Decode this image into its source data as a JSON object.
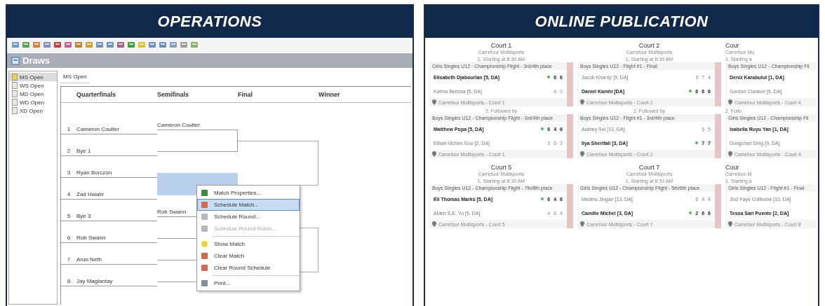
{
  "operations": {
    "heading": "OPERATIONS",
    "panel_title": "Draws",
    "draws": [
      {
        "label": "MS Open",
        "selected": true
      },
      {
        "label": "WS Open",
        "selected": false
      },
      {
        "label": "MD Open",
        "selected": false
      },
      {
        "label": "WD Open",
        "selected": false
      },
      {
        "label": "XD Open",
        "selected": false
      }
    ],
    "tab": "MS Open",
    "columns": [
      "Quarterfinals",
      "Semifinals",
      "Final",
      "Winner"
    ],
    "quarterfinals": [
      {
        "seed": "1",
        "name": "Cameron Coulter"
      },
      {
        "seed": "2",
        "name": "Bye 1"
      },
      {
        "seed": "3",
        "name": "Ryan Borczon"
      },
      {
        "seed": "4",
        "name": "Zad Halabi"
      },
      {
        "seed": "5",
        "name": "Bye 3"
      },
      {
        "seed": "6",
        "name": "Rob Swann"
      },
      {
        "seed": "7",
        "name": "Arun Neth"
      },
      {
        "seed": "8",
        "name": "Jay Maglantay"
      }
    ],
    "semifinals": [
      {
        "name": "Cameron Coulter",
        "selected": false
      },
      {
        "selected": true
      },
      {
        "name": "Rob Swann",
        "selected": false
      },
      {
        "selected": false
      }
    ],
    "context_menu": [
      [
        {
          "label": "Match Properties...",
          "selected": false,
          "disabled": false
        },
        {
          "label": "Schedule Match...",
          "selected": true,
          "disabled": false
        },
        {
          "label": "Schedule Round...",
          "selected": false,
          "disabled": false
        },
        {
          "label": "Schedule Round Robin...",
          "selected": false,
          "disabled": true
        }
      ],
      [
        {
          "label": "Show Match",
          "selected": false,
          "disabled": false
        },
        {
          "label": "Clear Match",
          "selected": false,
          "disabled": false
        },
        {
          "label": "Clear Round Schedule",
          "selected": false,
          "disabled": false
        }
      ],
      [
        {
          "label": "Print...",
          "selected": false,
          "disabled": false
        }
      ]
    ]
  },
  "online_publication": {
    "heading": "ONLINE PUBLICATION",
    "courts": [
      {
        "title": "Court 1",
        "venue": "Carrefour Multisports",
        "matches": [
          {
            "order": "1. Starting at 8:30 AM",
            "event": "Girls Singles U12 - Championship Flight - 3rd/4th place",
            "players": [
              {
                "name": "Elisabeth Djabourian [5, DA]",
                "winner": true,
                "scores": [
                  "6",
                  "6"
                ]
              },
              {
                "name": "Karina Bersixa [5, DA]",
                "winner": false,
                "scores": [
                  "4",
                  "0"
                ]
              }
            ],
            "location": "Carrefour Multisports - Court 1"
          },
          {
            "order": "2. Followed by",
            "event": "Boys Singles U12 - Championship Flight - 3rd/4th place",
            "players": [
              {
                "name": "Matthew Popa [5, DA]",
                "winner": true,
                "scores": [
                  "6",
                  "4",
                  "6"
                ]
              },
              {
                "name": "Ethan Vichen Guo [2, DA]",
                "winner": false,
                "scores": [
                  "3",
                  "6",
                  "3"
                ]
              }
            ],
            "location": "Carrefour Multisports - Court 1"
          }
        ]
      },
      {
        "title": "Court 2",
        "venue": "Carrefour Multisports",
        "matches": [
          {
            "order": "1. Starting at 8:30 AM",
            "event": "Boys Singles U12 - Flight #1 - Final",
            "players": [
              {
                "name": "Jacob Kharrip [9, DA]",
                "winner": false,
                "scores": [
                  "3",
                  "7",
                  "4"
                ]
              },
              {
                "name": "Daniel Kamhi [DA]",
                "winner": true,
                "scores": [
                  "6",
                  "6",
                  "6"
                ]
              }
            ],
            "location": "Carrefour Multisports - Court 2"
          },
          {
            "order": "2. Followed by",
            "event": "Boys Singles U12 - Flight #1 - 3rd/4th place",
            "players": [
              {
                "name": "Aubrey Sui [13, DA]",
                "winner": false,
                "scores": [
                  "5",
                  "5"
                ]
              },
              {
                "name": "Ilya Sherifali [3, DA]",
                "winner": true,
                "scores": [
                  "7",
                  "7"
                ]
              }
            ],
            "location": "Carrefour Multisports - Court 2"
          }
        ]
      },
      {
        "title": "Cour",
        "venue": "Carrefour Mu",
        "matches": [
          {
            "order": "1. Starting a",
            "event": "Boys Singles U12 - Championship Fli",
            "players": [
              {
                "name": "Deniz Karabulut [1, DA]",
                "winner": true
              },
              {
                "name": "Gordon Ctankov [9, DA]",
                "winner": false
              }
            ],
            "location": "Carrefour Multisports - Court 4"
          },
          {
            "order": "2. Follo",
            "event": "Girls Singles U12 - Championship Fli",
            "players": [
              {
                "name": "Isabella Ruyu Yan [1, DA]",
                "winner": true
              },
              {
                "name": "Dongchen Ding [9, DA]",
                "winner": false
              }
            ],
            "location": "Carrefour Multisports - Court 4"
          }
        ]
      },
      {
        "title": "Court 5",
        "venue": "Carrefour Multisports",
        "matches": [
          {
            "order": "1. Starting at 8:30 AM",
            "event": "Boys Singles U12 - Championship Flight - 7th/8th place",
            "players": [
              {
                "name": "Eli Thomas Marks [5, DA]",
                "winner": true,
                "scores": [
                  "6",
                  "4",
                  "6"
                ]
              },
              {
                "name": "Alden S.E. Yu [5, DA]",
                "winner": false,
                "scores": [
                  "4",
                  "6",
                  "4"
                ]
              }
            ],
            "location": "Carrefour Multisports - Court 5"
          }
        ]
      },
      {
        "title": "Court 7",
        "venue": "Carrefour Multisports",
        "matches": [
          {
            "order": "1. Starting at 8:30 AM",
            "event": "Girls Singles U12 - Championship Flight - 5th/6th place",
            "players": [
              {
                "name": "Medina Jingan [13, DA]",
                "winner": false,
                "scores": [
                  "6",
                  "4",
                  "4"
                ]
              },
              {
                "name": "Camille Michel [3, DA]",
                "winner": true,
                "scores": [
                  "2",
                  "6",
                  "6"
                ]
              }
            ],
            "location": "Carrefour Multisports - Court 7"
          }
        ]
      },
      {
        "title": "Cour",
        "venue": "Carrefour M",
        "matches": [
          {
            "order": "1. Starting a",
            "event": "Girls Singles U12 - Flight #1 - Final",
            "players": [
              {
                "name": "Joci Faye Colburne [13, DA]",
                "winner": false
              },
              {
                "name": "Tessa Sari Puente [2, DA]",
                "winner": true
              }
            ],
            "location": "Carrefour Multisports - Court 8"
          }
        ]
      }
    ]
  }
}
